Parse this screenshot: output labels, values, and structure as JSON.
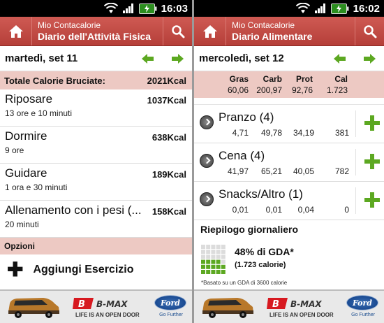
{
  "status": {
    "left_time": "16:03",
    "right_time": "16:02"
  },
  "left": {
    "app_name": "Mio Contacalorie",
    "screen_title": "Diario dell'Attività Fisica",
    "date": "martedì, set 11",
    "total_label": "Totale Calorie Bruciate:",
    "total_value": "2021Kcal",
    "activities": [
      {
        "name": "Riposare",
        "duration": "13 ore e 10 minuti",
        "kcal": "1037Kcal"
      },
      {
        "name": "Dormire",
        "duration": "9 ore",
        "kcal": "638Kcal"
      },
      {
        "name": "Guidare",
        "duration": "1 ora e 30 minuti",
        "kcal": "189Kcal"
      },
      {
        "name": "Allenamento con i pesi (...",
        "duration": "20 minuti",
        "kcal": "158Kcal"
      }
    ],
    "options_header": "Opzioni",
    "add_exercise": "Aggiungi Esercizio"
  },
  "right": {
    "app_name": "Mio Contacalorie",
    "screen_title": "Diario Alimentare",
    "date": "mercoledì, set 12",
    "macro_labels": [
      "Gras",
      "Carb",
      "Prot",
      "Cal"
    ],
    "macro_totals": [
      "60,06",
      "200,97",
      "92,76",
      "1.723"
    ],
    "meals": [
      {
        "name": "Pranzo (4)",
        "values": [
          "4,71",
          "49,78",
          "34,19",
          "381"
        ]
      },
      {
        "name": "Cena (4)",
        "values": [
          "41,97",
          "65,21",
          "40,05",
          "782"
        ]
      },
      {
        "name": "Snacks/Altro (1)",
        "values": [
          "0,01",
          "0,01",
          "0,04",
          "0"
        ]
      }
    ],
    "summary_title": "Riepilogo giornaliero",
    "gda_percent": "48% di GDA*",
    "gda_calories": "(1.723 calorie)",
    "gda_fraction": 0.48,
    "note": "*Basato su un GDA di 3600 calorie"
  },
  "ad": {
    "brand": "B-MAX",
    "slogan": "LIFE IS AN OPEN DOOR",
    "logo": "Ford",
    "tagline": "Go Further"
  },
  "colors": {
    "accent": "#c24a44",
    "section_bg": "#edc9c3",
    "green": "#5ca821"
  },
  "icons": [
    "home-icon",
    "search-icon",
    "arrow-left-icon",
    "arrow-right-icon",
    "plus-icon",
    "expand-icon",
    "wifi-icon",
    "signal-icon",
    "battery-icon"
  ]
}
